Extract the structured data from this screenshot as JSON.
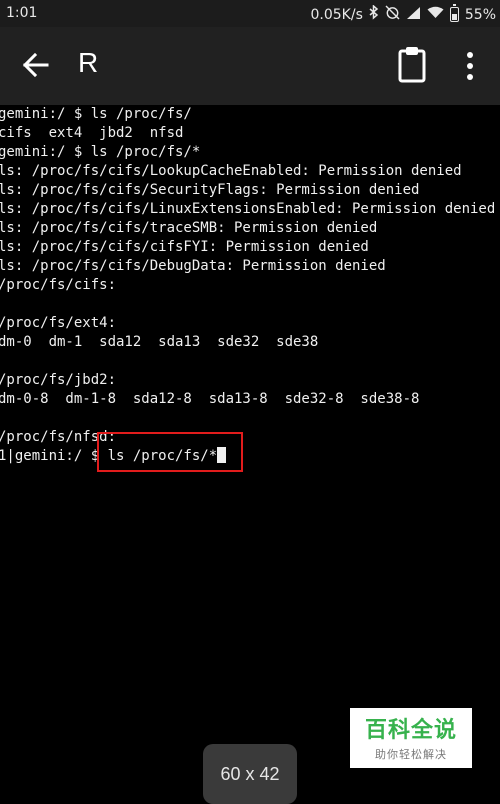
{
  "status_bar": {
    "time": "1:01",
    "network_speed": "0.05K/s",
    "icons": [
      "bluetooth-icon",
      "alarm-off-icon",
      "signal-icon",
      "wifi-icon",
      "battery-icon"
    ],
    "battery": "55%"
  },
  "toolbar": {
    "title": "R",
    "icons": [
      "back-arrow-icon",
      "clipboard-icon",
      "more-vert-icon"
    ]
  },
  "terminal": {
    "lines": [
      "gemini:/ $ ls /proc/fs/",
      "cifs  ext4  jbd2  nfsd",
      "gemini:/ $ ls /proc/fs/*",
      "ls: /proc/fs/cifs/LookupCacheEnabled: Permission denied",
      "ls: /proc/fs/cifs/SecurityFlags: Permission denied",
      "ls: /proc/fs/cifs/LinuxExtensionsEnabled: Permission denied",
      "ls: /proc/fs/cifs/traceSMB: Permission denied",
      "ls: /proc/fs/cifs/cifsFYI: Permission denied",
      "ls: /proc/fs/cifs/DebugData: Permission denied",
      "/proc/fs/cifs:",
      "",
      "/proc/fs/ext4:",
      "dm-0  dm-1  sda12  sda13  sde32  sde38",
      "",
      "/proc/fs/jbd2:",
      "dm-0-8  dm-1-8  sda12-8  sda13-8  sde32-8  sde38-8",
      "",
      "/proc/fs/nfsd:",
      "1|gemini:/ $ ls /proc/fs/*"
    ],
    "text_color": "#f0f0f0",
    "highlight_color": "#e21c1c"
  },
  "size_toast": {
    "text": "60 x 42"
  },
  "watermark": {
    "title": "百科全说",
    "subtitle": "助你轻松解决",
    "color": "#37b24d"
  }
}
